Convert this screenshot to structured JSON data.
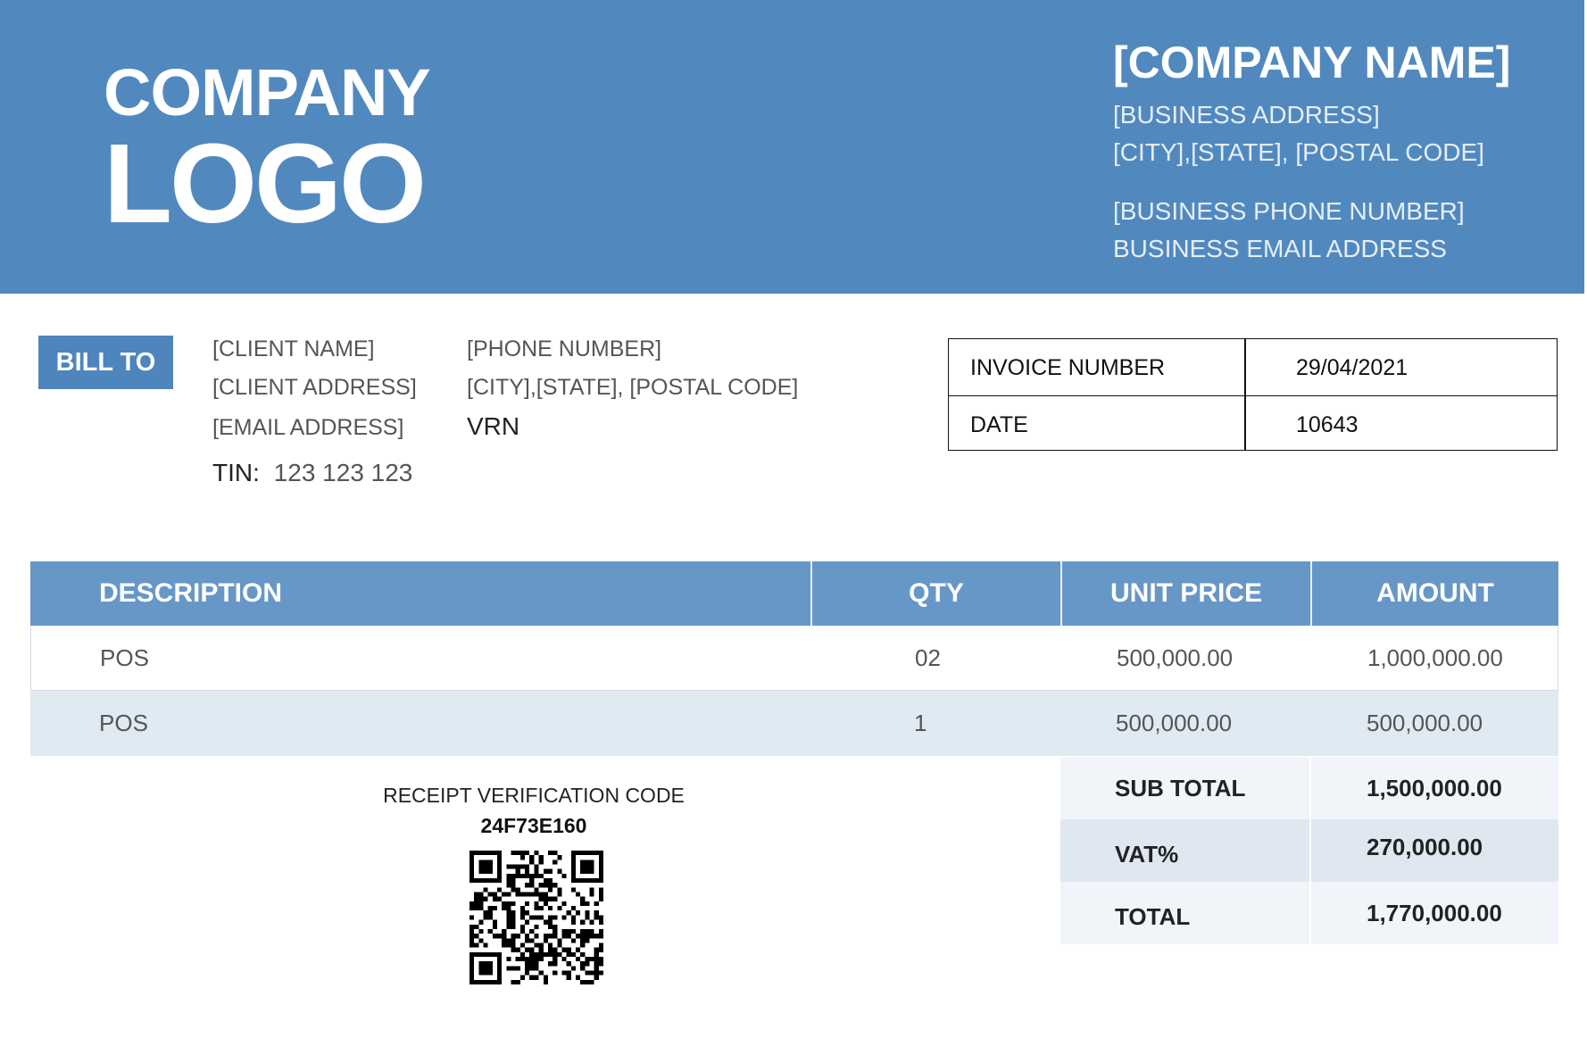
{
  "logo": {
    "line1": "COMPANY",
    "line2": "LOGO"
  },
  "company": {
    "name": "[COMPANY NAME]",
    "address": "[BUSINESS ADDRESS]",
    "city_state_postal": "[CITY],[STATE], [POSTAL CODE]",
    "phone": "[BUSINESS PHONE NUMBER]",
    "email": "BUSINESS EMAIL ADDRESS"
  },
  "bill_to": {
    "label": "BILL TO",
    "client_name": "[CLIENT NAME]",
    "client_address": "[CLIENT ADDRESS]",
    "email": "[EMAIL ADDRESS]",
    "tin_label": "TIN:",
    "tin_value": "123 123 123",
    "phone": "[PHONE NUMBER]",
    "city_state_postal": "[CITY],[STATE], [POSTAL CODE]",
    "vrn_label": "VRN"
  },
  "invoice": {
    "number_label": "INVOICE NUMBER",
    "number_value": "29/04/2021",
    "date_label": "DATE",
    "date_value": "10643"
  },
  "items": {
    "headers": {
      "description": "DESCRIPTION",
      "qty": "QTY",
      "unit_price": "UNIT PRICE",
      "amount": "AMOUNT"
    },
    "rows": [
      {
        "description": "POS",
        "qty": "02",
        "unit_price": "500,000.00",
        "amount": "1,000,000.00"
      },
      {
        "description": "POS",
        "qty": "1",
        "unit_price": "500,000.00",
        "amount": "500,000.00"
      }
    ]
  },
  "totals": {
    "subtotal_label": "SUB TOTAL",
    "subtotal_value": "1,500,000.00",
    "vat_label": "VAT%",
    "vat_value": "270,000.00",
    "total_label": "TOTAL",
    "total_value": "1,770,000.00"
  },
  "receipt": {
    "label": "RECEIPT VERIFICATION CODE",
    "code": "24F73E160"
  },
  "colors": {
    "header_bg": "#5189bf",
    "table_header_bg": "#6797c7",
    "row_alt_bg": "#e0eaf3"
  }
}
